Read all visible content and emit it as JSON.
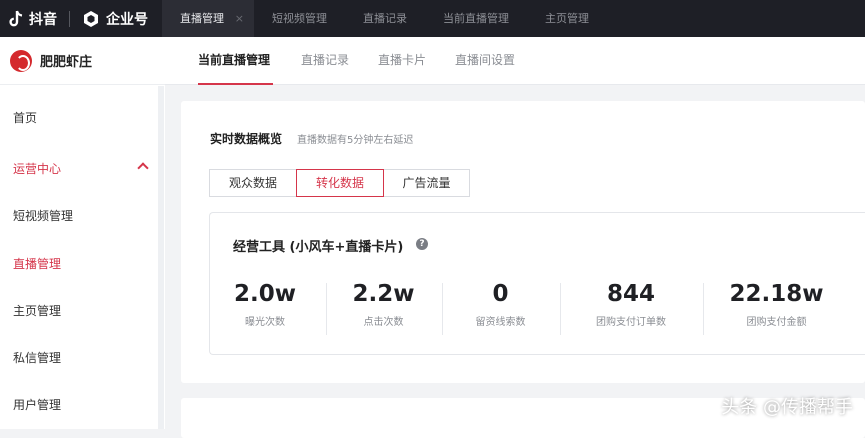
{
  "topbar": {
    "app_name": "抖音",
    "enterprise_label": "企业号",
    "tabs": [
      {
        "label": "直播管理",
        "active": true
      },
      {
        "label": "短视频管理",
        "active": false
      },
      {
        "label": "直播记录",
        "active": false
      },
      {
        "label": "当前直播管理",
        "active": false
      },
      {
        "label": "主页管理",
        "active": false
      }
    ],
    "close_glyph": "×"
  },
  "sidebar": {
    "shop_name": "肥肥虾庄",
    "items": [
      {
        "label": "首页"
      },
      {
        "label": "运营中心",
        "expanded": true
      },
      {
        "label": "短视频管理"
      },
      {
        "label": "直播管理",
        "active": true
      },
      {
        "label": "主页管理"
      },
      {
        "label": "私信管理"
      },
      {
        "label": "用户管理"
      }
    ]
  },
  "content_tabs": [
    {
      "label": "当前直播管理",
      "active": true
    },
    {
      "label": "直播记录"
    },
    {
      "label": "直播卡片"
    },
    {
      "label": "直播间设置"
    }
  ],
  "overview": {
    "title": "实时数据概览",
    "note": "直播数据有5分钟左右延迟",
    "segments": [
      {
        "label": "观众数据"
      },
      {
        "label": "转化数据",
        "active": true
      },
      {
        "label": "广告流量"
      }
    ],
    "metrics_title": "经营工具 (小风车+直播卡片)",
    "help_glyph": "?",
    "metrics": [
      {
        "value": "2.0w",
        "label": "曝光次数"
      },
      {
        "value": "2.2w",
        "label": "点击次数"
      },
      {
        "value": "0",
        "label": "留资线索数"
      },
      {
        "value": "844",
        "label": "团购支付订单数"
      },
      {
        "value": "22.18w",
        "label": "团购支付金额"
      }
    ]
  },
  "watermark": "头条 @传播帮手",
  "colors": {
    "accent": "#d5354a",
    "topbar_bg": "#1e1f26"
  }
}
